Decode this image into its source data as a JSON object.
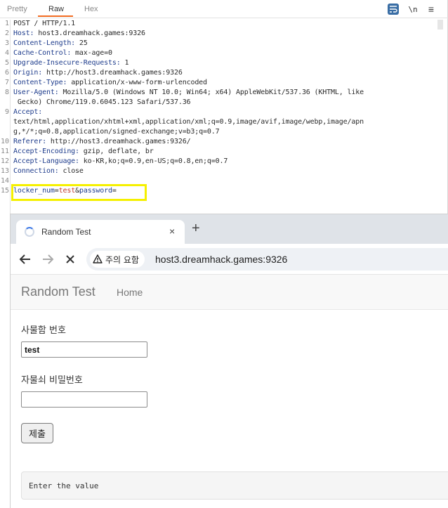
{
  "burp": {
    "tabs": [
      "Pretty",
      "Raw",
      "Hex"
    ],
    "active_tab": "Raw",
    "toolbar_newline": "\\n",
    "toolbar_menu": "≡",
    "lines": [
      {
        "n": "1",
        "key": "POST / HTTP/1.1",
        "val": ""
      },
      {
        "n": "2",
        "key": "Host:",
        "val": " host3.dreamhack.games:9326"
      },
      {
        "n": "3",
        "key": "Content-Length:",
        "val": " 25"
      },
      {
        "n": "4",
        "key": "Cache-Control:",
        "val": " max-age=0"
      },
      {
        "n": "5",
        "key": "Upgrade-Insecure-Requests:",
        "val": " 1"
      },
      {
        "n": "6",
        "key": "Origin:",
        "val": " http://host3.dreamhack.games:9326"
      },
      {
        "n": "7",
        "key": "Content-Type:",
        "val": " application/x-www-form-urlencoded"
      },
      {
        "n": "8",
        "key": "User-Agent:",
        "val": " Mozilla/5.0 (Windows NT 10.0; Win64; x64) AppleWebKit/537.36 (KHTML, like"
      },
      {
        "n": "",
        "key": "",
        "val": " Gecko) Chrome/119.0.6045.123 Safari/537.36"
      },
      {
        "n": "9",
        "key": "Accept:",
        "val": ""
      },
      {
        "n": "",
        "key": "",
        "val": "text/html,application/xhtml+xml,application/xml;q=0.9,image/avif,image/webp,image/apn"
      },
      {
        "n": "",
        "key": "",
        "val": "g,*/*;q=0.8,application/signed-exchange;v=b3;q=0.7"
      },
      {
        "n": "10",
        "key": "Referer:",
        "val": " http://host3.dreamhack.games:9326/"
      },
      {
        "n": "11",
        "key": "Accept-Encoding:",
        "val": " gzip, deflate, br"
      },
      {
        "n": "12",
        "key": "Accept-Language:",
        "val": " ko-KR,ko;q=0.9,en-US;q=0.8,en;q=0.7"
      },
      {
        "n": "13",
        "key": "Connection:",
        "val": " close"
      },
      {
        "n": "14",
        "key": "",
        "val": ""
      },
      {
        "n": "15",
        "key": "",
        "val": ""
      }
    ],
    "body_param1_key": "locker_num",
    "body_eq1": "=",
    "body_param1_val": "test",
    "body_amp": "&",
    "body_param2_key": "password",
    "body_eq2": "=",
    "highlight_color": "#f5f000"
  },
  "browser": {
    "tab_title": "Random Test",
    "tab_close": "×",
    "new_tab": "+",
    "warning_label": "주의 요함",
    "url": "host3.dreamhack.games:9326"
  },
  "page": {
    "brand": "Random Test",
    "nav_home": "Home",
    "locker_label": "사물함 번호",
    "locker_value": "test",
    "password_label": "자물쇠 비밀번호",
    "password_value": "",
    "submit_label": "제출",
    "result_text": "Enter the value"
  }
}
